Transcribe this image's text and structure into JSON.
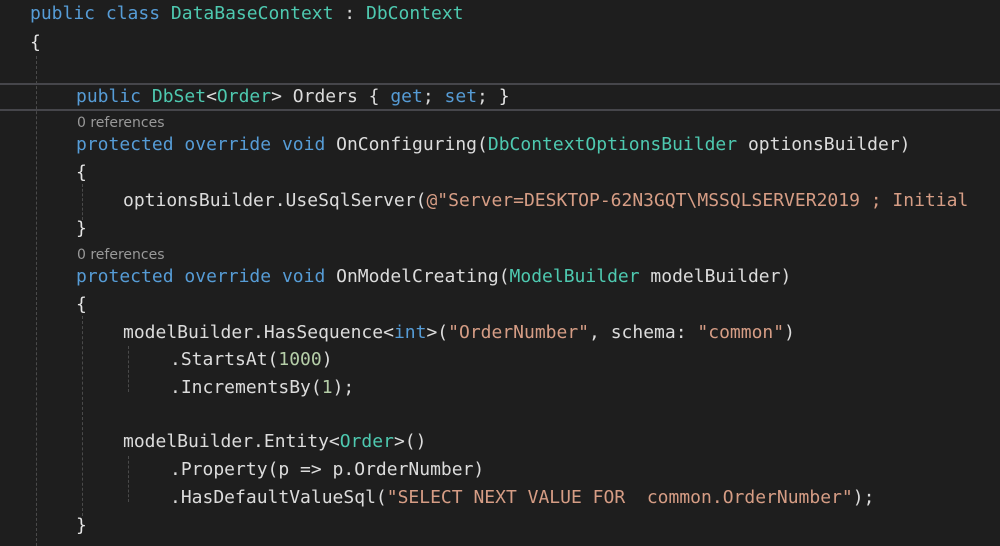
{
  "editor": {
    "codelens_1": "0 references",
    "codelens_2": "0 references"
  },
  "code": {
    "l1": {
      "k1": "public",
      "k2": "class",
      "name": "DataBaseContext",
      "sep": " : ",
      "base": "DbContext"
    },
    "l2": {
      "brace": "{"
    },
    "l3": {
      "k1": "public",
      "t1": "DbSet",
      "lt": "<",
      "t2": "Order",
      "gt": ">",
      "rest": " Orders { ",
      "get": "get",
      "semi1": "; ",
      "set": "set",
      "semi2": "; ",
      "close": "}"
    },
    "l4": {
      "k1": "protected",
      "k2": "override",
      "k3": "void",
      "method": " OnConfiguring(",
      "t1": "DbContextOptionsBuilder",
      "param": " optionsBuilder)"
    },
    "l5": {
      "brace": "{"
    },
    "l6": {
      "call": "optionsBuilder.UseSqlServer(",
      "str": "@\"Server=DESKTOP-62N3GQT\\MSSQLSERVER2019 ; Initial"
    },
    "l7": {
      "brace": "}"
    },
    "l8": {
      "k1": "protected",
      "k2": "override",
      "k3": "void",
      "method": " OnModelCreating(",
      "t1": "ModelBuilder",
      "param": " modelBuilder)"
    },
    "l9": {
      "brace": "{"
    },
    "l10": {
      "call": "modelBuilder.HasSequence",
      "lt": "<",
      "t1": "int",
      "gt": ">",
      "open": "(",
      "str1": "\"OrderNumber\"",
      "mid": ", schema: ",
      "str2": "\"common\"",
      "close": ")"
    },
    "l11": {
      "call": ".StartsAt(",
      "num": "1000",
      "close": ")"
    },
    "l12": {
      "call": ".IncrementsBy(",
      "num": "1",
      "close": ");"
    },
    "l13": {
      "call": "modelBuilder.Entity",
      "lt": "<",
      "t1": "Order",
      "gt": ">",
      "close": "()"
    },
    "l14": {
      "text": ".Property(p => p.OrderNumber)"
    },
    "l15": {
      "call": ".HasDefaultValueSql(",
      "str": "\"SELECT NEXT VALUE FOR  common.OrderNumber\"",
      "close": ");"
    },
    "l16": {
      "brace": "}"
    }
  }
}
